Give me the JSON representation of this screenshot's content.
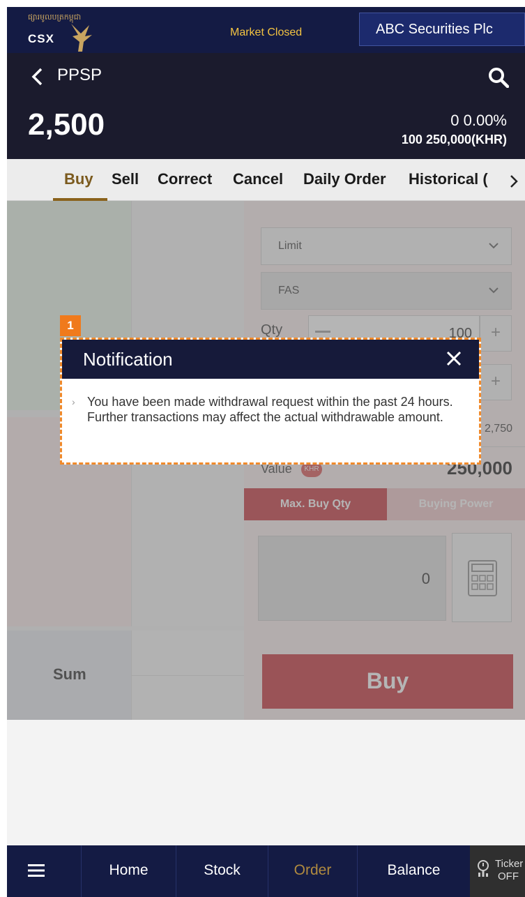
{
  "header": {
    "logo_khmer": "ផ្សារមូលបត្រកម្ពុជា",
    "logo_text": "CSX",
    "market_status": "Market Closed",
    "broker_name": "ABC Securities Plc"
  },
  "stock": {
    "code": "PPSP",
    "price": "2,500",
    "change": "0  0.00%",
    "volume_line": "100  250,000(KHR)"
  },
  "tabs": [
    {
      "label": "Buy",
      "active": true
    },
    {
      "label": "Sell"
    },
    {
      "label": "Correct"
    },
    {
      "label": "Cancel"
    },
    {
      "label": "Daily Order"
    },
    {
      "label": "Historical ("
    }
  ],
  "orderbook": {
    "sum_label": "Sum"
  },
  "order_panel": {
    "order_type": "Limit",
    "account_type": "FAS",
    "qty_label": "Qty",
    "qty_value": "100",
    "price_limit": "2,750",
    "value_label": "Value",
    "value_currency_icon": "KHR",
    "value": "250,000",
    "toggle_max_buy": "Max. Buy Qty",
    "toggle_buying_power": "Buying Power",
    "amount": "0",
    "buy_button": "Buy"
  },
  "modal": {
    "badge": "1",
    "title": "Notification",
    "message": "You have been made withdrawal request within the past 24 hours. Further transactions may affect the actual withdrawable amount.",
    "bullet": "›"
  },
  "bottom_nav": {
    "items": [
      "Home",
      "Stock",
      "Order",
      "Balance"
    ],
    "active": "Order",
    "ticker_line1": "Ticker",
    "ticker_line2": "OFF"
  },
  "colors": {
    "navy": "#141b44",
    "accent_gold": "#b08a3f",
    "buy_red": "#c4262f",
    "highlight_orange": "#f08a2b"
  }
}
